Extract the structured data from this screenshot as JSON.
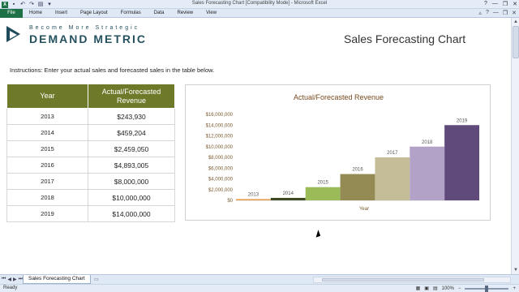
{
  "window": {
    "title": "Sales Forecasting Chart  [Compatibility Mode]  -  Microsoft Excel",
    "controls": [
      "?",
      "—",
      "❐",
      "✕"
    ]
  },
  "ribbon": {
    "file_label": "File",
    "tabs": [
      "Home",
      "Insert",
      "Page Layout",
      "Formulas",
      "Data",
      "Review",
      "View"
    ]
  },
  "logo": {
    "tagline": "Become More Strategic",
    "name": "DEMAND METRIC"
  },
  "sheet": {
    "title": "Sales Forecasting Chart",
    "instructions": "Instructions: Enter your actual sales and forecasted sales in the table below."
  },
  "table": {
    "headers": [
      "Year",
      "Actual/Forecasted Revenue"
    ],
    "rows": [
      {
        "year": "2013",
        "revenue": "$243,930"
      },
      {
        "year": "2014",
        "revenue": "$459,204"
      },
      {
        "year": "2015",
        "revenue": "$2,459,050"
      },
      {
        "year": "2016",
        "revenue": "$4,893,005"
      },
      {
        "year": "2017",
        "revenue": "$8,000,000"
      },
      {
        "year": "2018",
        "revenue": "$10,000,000"
      },
      {
        "year": "2019",
        "revenue": "$14,000,000"
      }
    ]
  },
  "chart_data": {
    "type": "bar",
    "title": "Actual/Forecasted Revenue",
    "xlabel": "Year",
    "ylabel": "",
    "categories": [
      "2013",
      "2014",
      "2015",
      "2016",
      "2017",
      "2018",
      "2019"
    ],
    "values": [
      243930,
      459204,
      2459050,
      4893005,
      8000000,
      10000000,
      14000000
    ],
    "colors": [
      "#e8a050",
      "#3d4a24",
      "#9bbb59",
      "#948a54",
      "#c4bd97",
      "#b3a2c7",
      "#604a7b"
    ],
    "ylim": [
      0,
      16000000
    ],
    "yticks": [
      "$0",
      "$2,000,000",
      "$4,000,000",
      "$6,000,000",
      "$8,000,000",
      "$10,000,000",
      "$12,000,000",
      "$14,000,000",
      "$16,000,000"
    ],
    "ytick_values": [
      0,
      2000000,
      4000000,
      6000000,
      8000000,
      10000000,
      12000000,
      14000000,
      16000000
    ],
    "grid": false,
    "bar_labels": "category-above-bar",
    "legend": "none"
  },
  "sheet_tabs": {
    "active": "Sales Forecasting Chart"
  },
  "status": {
    "ready": "Ready",
    "zoom": "100%"
  },
  "colors": {
    "header_olive": "#6e7a2a",
    "excel_green": "#1e7145",
    "title_brown": "#7a4a1e"
  }
}
